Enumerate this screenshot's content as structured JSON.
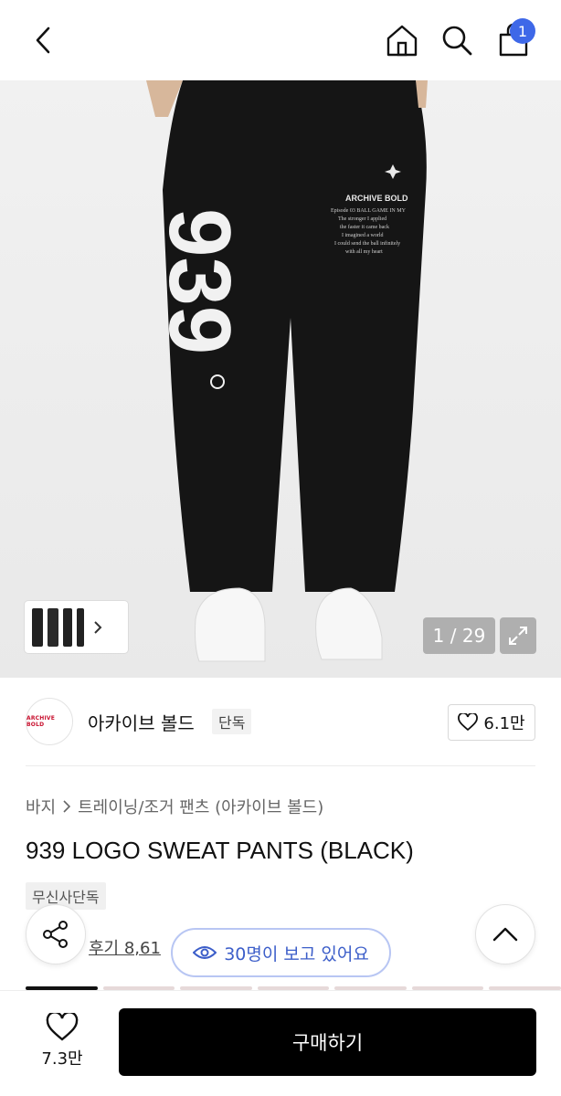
{
  "header": {
    "back_icon": "chevron-left-icon",
    "home_icon": "home-icon",
    "search_icon": "search-icon",
    "cart_icon": "shopping-bag-icon",
    "cart_count": "1",
    "badge_color": "#3e68e8"
  },
  "gallery": {
    "counter": "1 / 29",
    "expand_icon": "expand-icon",
    "print_number": "939",
    "print_brand": "ARCHIVE BOLD",
    "print_line1": "Episode 03  BALL GAME IN MY",
    "print_line2": "The stronger I applied",
    "print_line3": "the faster it came back",
    "print_line4": "I imagined a world",
    "print_line5": "I could send the ball infinitely",
    "print_line6": "with all my heart"
  },
  "brand": {
    "logo_text": "ARCHIVE BOLD",
    "name": "아카이브 볼드",
    "exclusive_tag": "단독",
    "likes": "6.1만"
  },
  "breadcrumb": {
    "category": "바지",
    "subcategory": "트레이닝/조거 팬츠 (아카이브 볼드)"
  },
  "product": {
    "title": "939 LOGO SWEAT PANTS (BLACK)",
    "tag": "무신사단독",
    "review_text": "후기 8,61"
  },
  "viewers": {
    "text": "30명이 보고 있어요",
    "color": "#3c5ec9"
  },
  "bottom": {
    "wish_count": "7.3만",
    "buy_label": "구매하기"
  }
}
